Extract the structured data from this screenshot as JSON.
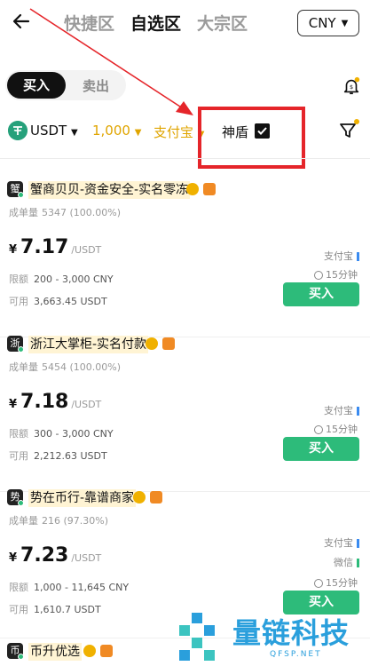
{
  "header": {
    "tabs": [
      {
        "label": "快捷区",
        "active": false
      },
      {
        "label": "自选区",
        "active": true
      },
      {
        "label": "大宗区",
        "active": false
      }
    ],
    "currency": "CNY"
  },
  "toggle": {
    "buy": "买入",
    "sell": "卖出"
  },
  "filters": {
    "coin": "USDT",
    "amount": "1,000",
    "payment": "支付宝",
    "shield": "神盾",
    "shield_checked": true
  },
  "offers": [
    {
      "avatar": "蟹",
      "name": "蟹商贝贝-资金安全-实名零冻",
      "volume_label": "成单量",
      "volume": "5347 (100.00%)",
      "currency_symbol": "¥",
      "price": "7.17",
      "price_unit": "/USDT",
      "limit_label": "限额",
      "limit": "200 - 3,000 CNY",
      "avail_label": "可用",
      "available": "3,663.45 USDT",
      "payments": [
        "支付宝"
      ],
      "time": "15分钟",
      "buy_label": "买入"
    },
    {
      "avatar": "浙",
      "name": "浙江大掌柜-实名付款",
      "volume_label": "成单量",
      "volume": "5454 (100.00%)",
      "currency_symbol": "¥",
      "price": "7.18",
      "price_unit": "/USDT",
      "limit_label": "限额",
      "limit": "300 - 3,000 CNY",
      "avail_label": "可用",
      "available": "2,212.63 USDT",
      "payments": [
        "支付宝"
      ],
      "time": "15分钟",
      "buy_label": "买入"
    },
    {
      "avatar": "势",
      "name": "势在币行-靠谱商家",
      "volume_label": "成单量",
      "volume": "216 (97.30%)",
      "currency_symbol": "¥",
      "price": "7.23",
      "price_unit": "/USDT",
      "limit_label": "限额",
      "limit": "1,000 - 11,645 CNY",
      "avail_label": "可用",
      "available": "1,610.7 USDT",
      "payments": [
        "支付宝",
        "微信"
      ],
      "time": "15分钟",
      "buy_label": "买入"
    },
    {
      "avatar": "币",
      "name": "币升优选"
    }
  ],
  "watermark": {
    "title": "量链科技",
    "domain": "QFSP.NET"
  },
  "colors": {
    "accent_gold": "#e0a500",
    "buy_green": "#2dbb7a",
    "annotation_red": "#e5252a"
  }
}
